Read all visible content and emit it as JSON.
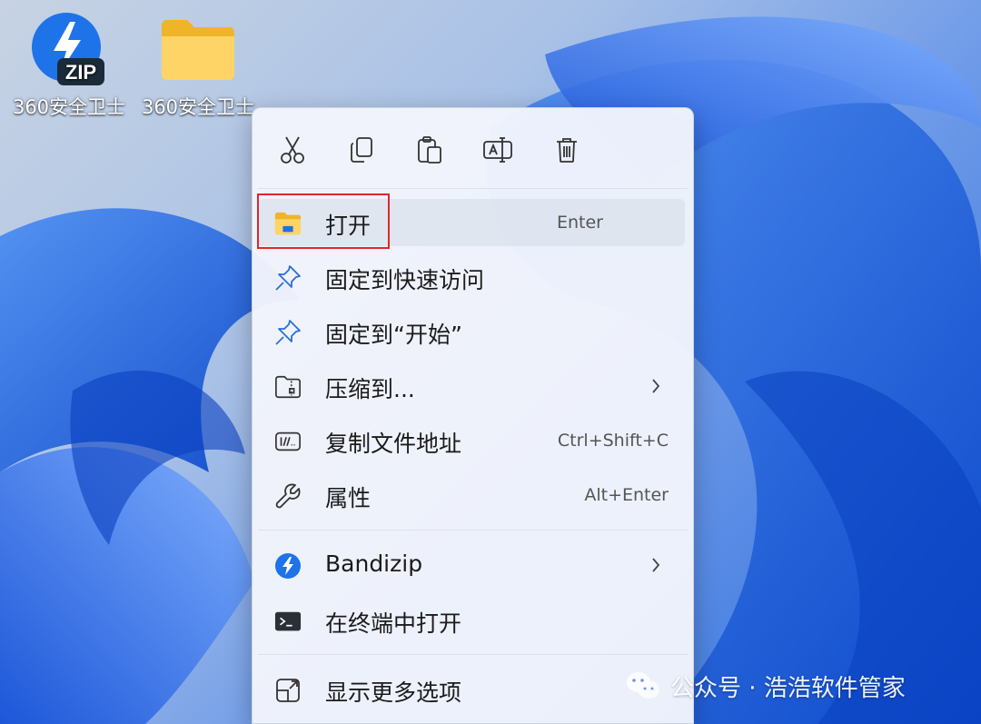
{
  "desktop": {
    "icons": [
      {
        "label": "360安全卫士",
        "badge": "ZIP",
        "icon": "zip-archive-icon"
      },
      {
        "label": "360安全卫士",
        "icon": "folder-icon"
      }
    ]
  },
  "context_menu": {
    "toolbar": [
      {
        "icon": "cut-icon"
      },
      {
        "icon": "copy-icon"
      },
      {
        "icon": "paste-icon"
      },
      {
        "icon": "rename-icon"
      },
      {
        "icon": "delete-icon"
      }
    ],
    "items": [
      {
        "label": "打开",
        "shortcut": "Enter",
        "icon": "folder-open-icon"
      },
      {
        "label": "固定到快速访问",
        "icon": "pin-icon"
      },
      {
        "label": "固定到“开始”",
        "icon": "pin-icon"
      },
      {
        "label": "压缩到...",
        "icon": "archive-icon",
        "has_submenu": true
      },
      {
        "label": "复制文件地址",
        "shortcut": "Ctrl+Shift+C",
        "icon": "copy-path-icon"
      },
      {
        "label": "属性",
        "shortcut": "Alt+Enter",
        "icon": "wrench-icon"
      },
      {
        "label": "Bandizip",
        "icon": "bandizip-icon",
        "has_submenu": true
      },
      {
        "label": "在终端中打开",
        "icon": "terminal-icon"
      },
      {
        "label": "显示更多选项",
        "icon": "show-more-options-icon"
      }
    ]
  },
  "watermark": {
    "text": "公众号 · 浩浩软件管家",
    "icon": "wechat-icon"
  },
  "colors": {
    "highlight_border": "#e0262b",
    "accent": "#1a73e8"
  }
}
